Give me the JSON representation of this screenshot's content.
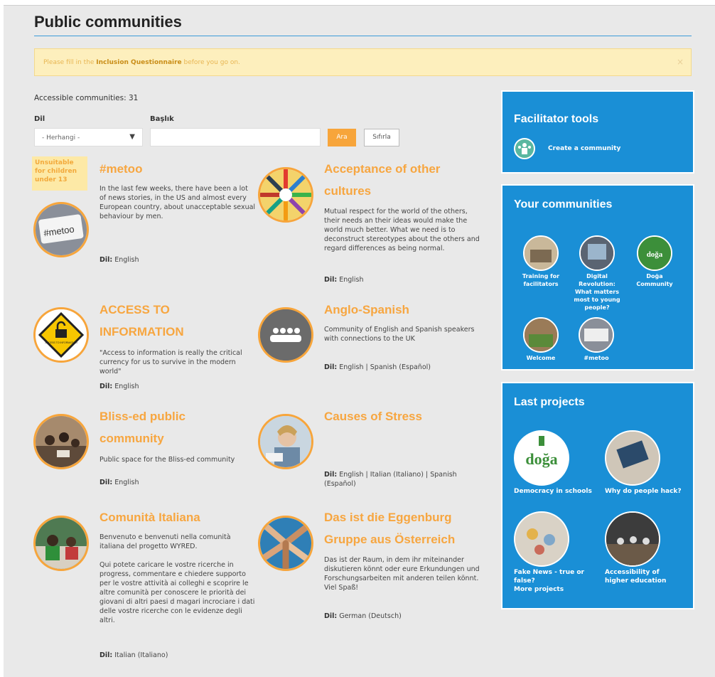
{
  "page": {
    "title": "Public communities",
    "alert": {
      "pre": "Please fill in the ",
      "link": "Inclusion Questionnaire",
      "post": " before you go on.",
      "close": "×"
    },
    "accessible": "Accessible communities: 31"
  },
  "filters": {
    "lang_label": "Dil",
    "lang_value": "- Herhangi -",
    "title_label": "Başlık",
    "title_value": "",
    "search_button": "Ara",
    "reset_button": "Sıfırla"
  },
  "badge": "Unsuitable for children under 13",
  "lang_prefix": "Dil:",
  "communities": [
    {
      "title_l1": "#metoo",
      "title_l2": "",
      "desc": "In the last few weeks, there have been a lot of news stories, in the US and almost every European country, about unacceptable sexual behaviour by men.",
      "lang": " English"
    },
    {
      "title_l1": "Acceptance of other",
      "title_l2": "cultures",
      "desc": "Mutual respect for the world of  the others, their needs an their ideas would make the world much better. What we need is to deconstruct stereotypes about the others and regard differences as being normal.",
      "lang": " English"
    },
    {
      "title_l1": "ACCESS TO",
      "title_l2": "INFORMATION",
      "desc": "\"Access to information is really the critical currency for us to survive in the modern world\"",
      "lang": " English"
    },
    {
      "title_l1": "Anglo-Spanish",
      "title_l2": "",
      "desc": "Community of English and Spanish speakers with connections to the UK",
      "lang": " English | Spanish (Español)"
    },
    {
      "title_l1": "Bliss-ed public",
      "title_l2": "community",
      "desc": "Public space for the Bliss-ed community",
      "lang": " English"
    },
    {
      "title_l1": "Causes of Stress",
      "title_l2": "",
      "desc": "",
      "lang": " English | Italian (Italiano) | Spanish (Español)"
    },
    {
      "title_l1": "Comunità Italiana",
      "title_l2": "",
      "desc": "Benvenuto e benvenuti nella comunità italiana del progetto WYRED.",
      "desc2": "Qui potete caricare le vostre ricerche in progress, commentare e chiedere supporto per le vostre attività ai colleghi e scoprire le altre comunità per conoscere le priorità dei giovani di altri paesi d magari incrociare i dati delle vostre ricerche con le evidenze degli altri.",
      "lang": " Italian (Italiano)"
    },
    {
      "title_l1": "Das ist die Eggenburg",
      "title_l2": "Gruppe aus Österreich",
      "desc": "Das ist der Raum, in dem ihr miteinander diskutieren könnt oder eure Erkundungen und Forschungsarbeiten mit anderen teilen könnt. Viel Spaß!",
      "lang": " German (Deutsch)"
    }
  ],
  "sidebar": {
    "tools": {
      "title": "Facilitator tools",
      "create": "Create a community"
    },
    "yours": {
      "title": "Your communities",
      "items": [
        {
          "label": "Training for facilitators"
        },
        {
          "label": "Digital Revolution: What matters most to young people?"
        },
        {
          "label": "Doğa Community"
        },
        {
          "label": "Welcome"
        },
        {
          "label": "#metoo"
        }
      ]
    },
    "projects": {
      "title": "Last projects",
      "items": [
        {
          "label": "Democracy in schools"
        },
        {
          "label": "Why do people hack?"
        },
        {
          "label": "Fake News - true or false?"
        },
        {
          "label": "Accessibility of higher education"
        }
      ],
      "more": "More projects"
    }
  },
  "logo_text": {
    "doga": "doğa",
    "metoo": "#metoo",
    "access": "ACCESS TO INFORMATION"
  },
  "colors": {
    "accent": "#f7a53b",
    "sidebar": "#1a8fd6",
    "alert_bg": "#fdefbd",
    "rule": "#3b9bd8"
  }
}
